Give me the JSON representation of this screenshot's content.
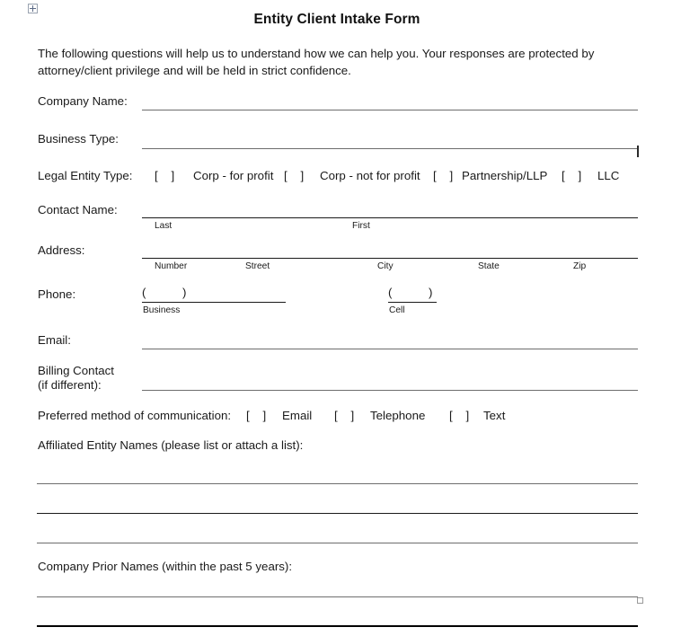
{
  "document": {
    "title": "Entity Client Intake Form",
    "intro": "The following questions will help us to understand how we can help you. Your responses are protected by attorney/client privilege and will be held in strict confidence."
  },
  "handles": {
    "table_move_handle": "move-handle-icon",
    "resize_handle": "resize-handle-icon"
  },
  "fields": {
    "company_name": {
      "label": "Company Name:",
      "value": ""
    },
    "business_type": {
      "label": "Business Type:",
      "value": ""
    },
    "legal_entity_type": {
      "label": "Legal Entity Type:",
      "options": [
        {
          "box": "[    ]",
          "label": "Corp - for profit",
          "checked": false
        },
        {
          "box": "[    ]",
          "label": "Corp - not for profit",
          "checked": false
        },
        {
          "box": "[    ]",
          "label": "Partnership/LLP",
          "checked": false
        },
        {
          "box": "[    ]",
          "label": "LLC",
          "checked": false
        }
      ]
    },
    "contact_name": {
      "label": "Contact Name:",
      "value": "",
      "sublabels": [
        "Last",
        "First"
      ]
    },
    "address": {
      "label": "Address:",
      "value": "",
      "sublabels": [
        "Number",
        "Street",
        "City",
        "State",
        "Zip"
      ]
    },
    "phone": {
      "label": "Phone:",
      "business": {
        "open_paren": "(",
        "close_paren": ")",
        "sublabel": "Business",
        "value": ""
      },
      "cell": {
        "open_paren": "(",
        "close_paren": ")",
        "sublabel": "Cell",
        "value": ""
      }
    },
    "email": {
      "label": "Email:",
      "value": ""
    },
    "billing_contact": {
      "label_line1": "Billing Contact",
      "label_line2": "(if different):",
      "value": ""
    },
    "preferred_method": {
      "label": "Preferred method of communication:",
      "options": [
        {
          "box": "[    ]",
          "label": "Email",
          "checked": false
        },
        {
          "box": "[    ]",
          "label": "Telephone",
          "checked": false
        },
        {
          "box": "[    ]",
          "label": "Text",
          "checked": false
        }
      ]
    },
    "affiliated_entity_names": {
      "label": "Affiliated Entity Names (please list or attach a list):",
      "lines": [
        "",
        "",
        ""
      ]
    },
    "company_prior_names": {
      "label": "Company Prior Names (within the past 5 years):",
      "lines": [
        "",
        ""
      ]
    }
  }
}
